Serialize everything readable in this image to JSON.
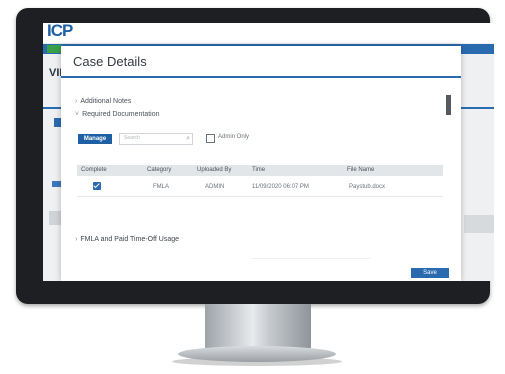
{
  "app": {
    "logo": "ICP",
    "view_heading": "VIEW"
  },
  "dialog": {
    "title": "Case Details",
    "sections": [
      {
        "label": "Additional Notes"
      },
      {
        "label": "Required Documentation"
      }
    ],
    "toolbar": {
      "manage_label": "Manage",
      "search_placeholder": "Search",
      "admin_only_label": "Admin Only",
      "admin_only_checked": false
    },
    "table": {
      "headers": [
        "Complete",
        "Category",
        "Uploaded By",
        "Time",
        "File Name"
      ],
      "rows": [
        {
          "complete": true,
          "category": "FMLA",
          "uploaded_by": "ADMIN",
          "time": "11/09/2020 06:07 PM",
          "file_name": "Paystub.docx"
        }
      ]
    },
    "fmla_section": "FMLA and Paid Time-Off Usage",
    "save_label": "Save"
  },
  "colors": {
    "accent": "#2a6bb0",
    "brand": "#1f5fa3",
    "green": "#3aa04a",
    "monitor_bezel": "#1d1f22"
  }
}
